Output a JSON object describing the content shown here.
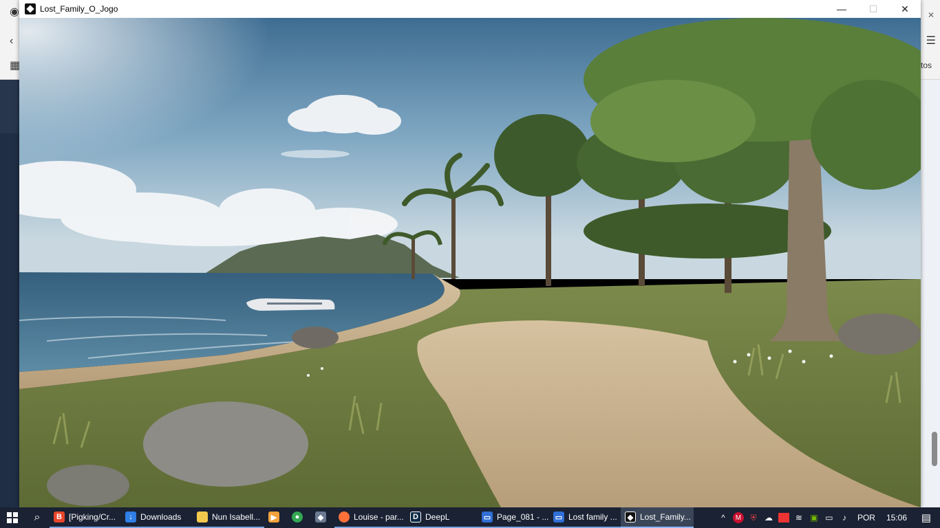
{
  "window": {
    "title": "Lost_Family_O_Jogo",
    "minimize_symbol": "—",
    "maximize_symbol": "☐",
    "close_symbol": "✕"
  },
  "background_app": {
    "partial_text": "tos"
  },
  "scene": {
    "description_icons": [
      "beach",
      "crashed-airplane",
      "palm-trees",
      "sandy-path",
      "rocks",
      "ocean",
      "cliffs",
      "clouds"
    ]
  },
  "taskbar": {
    "items": [
      {
        "label": "[Pigking/Cr...",
        "icon": "brave-icon",
        "color": "#e8462b",
        "state": "open"
      },
      {
        "label": "Downloads",
        "icon": "download-icon",
        "color": "#2f7fe6",
        "state": "open"
      },
      {
        "label": "Nun Isabell...",
        "icon": "folder-icon",
        "color": "#f2c94c",
        "state": "open"
      },
      {
        "label": "",
        "icon": "media-player-icon",
        "color": "#f2a23a",
        "state": "none"
      },
      {
        "label": "",
        "icon": "chrome-icon",
        "color": "#34a853",
        "state": "none"
      },
      {
        "label": "",
        "icon": "app-icon",
        "color": "#6b7a90",
        "state": "none"
      },
      {
        "label": "Louise - par...",
        "icon": "firefox-icon",
        "color": "#ff7139",
        "state": "open"
      },
      {
        "label": "DeepL",
        "icon": "deepl-icon",
        "color": "#0f2b46",
        "state": "open"
      },
      {
        "label": "Page_081 - ...",
        "icon": "window-icon",
        "color": "#2f6fd6",
        "state": "open"
      },
      {
        "label": "Lost family ...",
        "icon": "window-icon",
        "color": "#2f6fd6",
        "state": "open"
      },
      {
        "label": "Lost_Family...",
        "icon": "game-icon",
        "color": "#111111",
        "state": "active"
      }
    ],
    "tray": {
      "language": "POR",
      "time": "15:06"
    }
  }
}
